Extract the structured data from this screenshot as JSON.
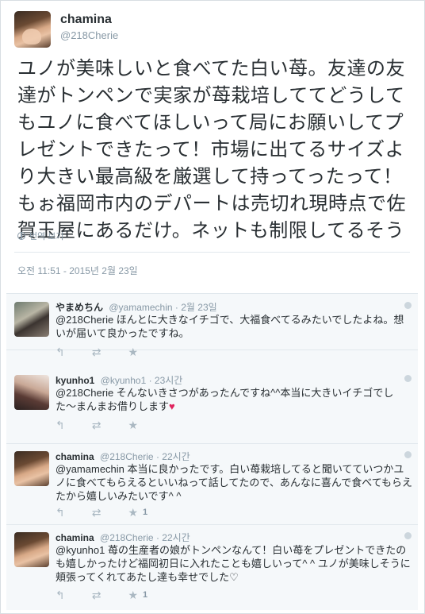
{
  "main": {
    "name": "chamina",
    "handle": "@218Cherie",
    "text": "ユノが美味しいと食べてた白い苺。友達の友達がトンペンで実家が苺栽培しててどうしてもユノに食べてほしいって局にお願いしてプレゼントできたって！市場に出てるサイズより大きい最高級を厳選して持ってったって！もぉ福岡市内のデパートは売切れ現時点で佐賀玉屋にあるだけ。ネットも制限してるそう",
    "translate": "번역 보기",
    "timestamp": "오전 11:51 - 2015년 2월 23일"
  },
  "replies": [
    {
      "name": "やまめちん",
      "handle": "@yamamechin",
      "time": "· 2월 23일",
      "text": "@218Cherie ほんとに大きなイチゴで、大福食べてるみたいでしたよね。想いが届いて良かったですね。",
      "fav_count": ""
    },
    {
      "name": "kyunho1",
      "handle": "@kyunho1",
      "time": "· 23시간",
      "text": "@218Cherie そんないきさつがあったんですね^^本当に大きいイチゴでした〜まんまお借りします",
      "heart": "♥",
      "fav_count": ""
    },
    {
      "name": "chamina",
      "handle": "@218Cherie",
      "time": "· 22시간",
      "text": "@yamamechin  本当に良かったです。白い苺栽培してると聞いてていつかユノに食べてもらえるといいねって話してたので、あんなに喜んで食べてもらえたから嬉しいみたいです^ ^",
      "fav_count": "1"
    },
    {
      "name": "chamina",
      "handle": "@218Cherie",
      "time": "· 22시간",
      "text": "@kyunho1 苺の生産者の娘がトンペンなんて！白い苺をプレゼントできたのも嬉しかったけど福岡初日に入れたことも嬉しいって^ ^ ユノが美味しそうに頬張ってくれてあたし達も幸せでした♡",
      "fav_count": "1"
    }
  ],
  "icons": {
    "reply": "reply-icon",
    "retweet": "retweet-icon",
    "favorite": "star-icon",
    "more": "more-icon"
  }
}
